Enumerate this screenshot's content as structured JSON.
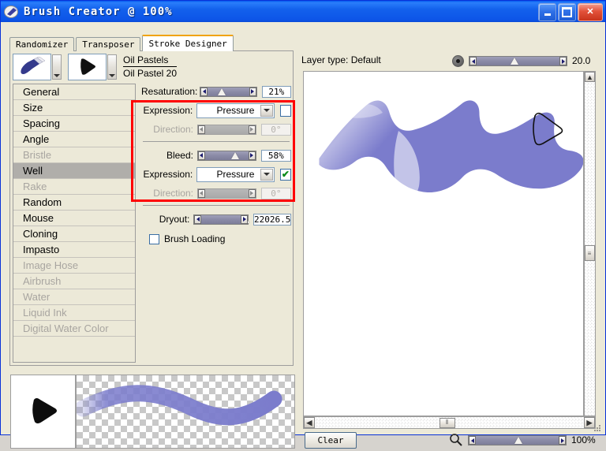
{
  "window": {
    "title": "Brush Creator @ 100%",
    "icon": "brush-app-icon",
    "buttons": {
      "minimize": "minimize-icon",
      "maximize": "maximize-icon",
      "close": "close-icon"
    }
  },
  "tabs": [
    {
      "label": "Randomizer",
      "active": false
    },
    {
      "label": "Transposer",
      "active": false
    },
    {
      "label": "Stroke Designer",
      "active": true
    }
  ],
  "brush_selector": {
    "category": "Oil Pastels",
    "variant": "Oil Pastel 20",
    "category_icon": "oil-pastel-brush-icon",
    "variant_icon": "triangle-dab-icon",
    "dropdown_icon": "chevron-down-icon"
  },
  "categories": [
    {
      "label": "General",
      "state": "normal"
    },
    {
      "label": "Size",
      "state": "normal"
    },
    {
      "label": "Spacing",
      "state": "normal"
    },
    {
      "label": "Angle",
      "state": "normal"
    },
    {
      "label": "Bristle",
      "state": "disabled"
    },
    {
      "label": "Well",
      "state": "selected"
    },
    {
      "label": "Rake",
      "state": "disabled"
    },
    {
      "label": "Random",
      "state": "normal"
    },
    {
      "label": "Mouse",
      "state": "normal"
    },
    {
      "label": "Cloning",
      "state": "normal"
    },
    {
      "label": "Impasto",
      "state": "normal"
    },
    {
      "label": "Image Hose",
      "state": "disabled"
    },
    {
      "label": "Airbrush",
      "state": "disabled"
    },
    {
      "label": "Water",
      "state": "disabled"
    },
    {
      "label": "Liquid Ink",
      "state": "disabled"
    },
    {
      "label": "Digital Water Color",
      "state": "disabled"
    }
  ],
  "well_settings": {
    "resaturation": {
      "label": "Resaturation:",
      "value": "21%",
      "percent": 21
    },
    "resaturation_expression": {
      "label": "Expression:",
      "value": "Pressure",
      "checkbox": "unchecked"
    },
    "resaturation_direction": {
      "label": "Direction:",
      "value": "0°",
      "percent": 0,
      "disabled": true
    },
    "bleed": {
      "label": "Bleed:",
      "value": "58%",
      "percent": 52
    },
    "bleed_expression": {
      "label": "Expression:",
      "value": "Pressure",
      "checkbox": "checked",
      "check_glyph": "✔"
    },
    "bleed_direction": {
      "label": "Direction:",
      "value": "0°",
      "percent": 0,
      "disabled": true
    },
    "dryout": {
      "label": "Dryout:",
      "value": "22026.5",
      "percent": 90
    },
    "brush_loading": {
      "label": "Brush Loading",
      "checked": false
    }
  },
  "canvas_area": {
    "layer_type_label": "Layer type: Default",
    "opacity_value": "20.0",
    "opacity_percent": 42,
    "toggle_icon": "record-dot-icon",
    "scroll_up_icon": "scroll-up-arrow-icon",
    "scroll_left_icon": "scroll-left-arrow-icon",
    "scroll_right_icon": "scroll-right-arrow-icon",
    "cursor_icon": "triangle-brush-cursor"
  },
  "footer": {
    "clear_label": "Clear",
    "zoom_icon": "magnifier-icon",
    "zoom_value": "100%",
    "zoom_percent": 48,
    "resize_grip": "resize-grip-icon"
  },
  "previews": {
    "dab_preview_icon": "brush-dab-preview",
    "stroke_preview_icon": "brush-stroke-preview"
  },
  "colors": {
    "stroke": "#7b7ccc",
    "highlight_box": "#ff0000",
    "title_bar": "#0d55e8",
    "tab_accent": "#f0a30a"
  }
}
